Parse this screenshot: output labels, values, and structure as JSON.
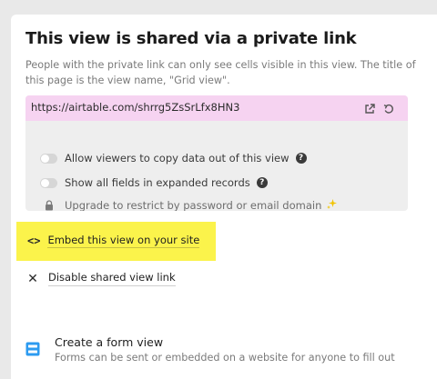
{
  "share": {
    "title": "This view is shared via a private link",
    "description": "People with the private link can only see cells visible in this view. The title of this page is the view name, \"Grid view\".",
    "url": "https://airtable.com/shrrg5ZsSrLfx8HN3",
    "url_actions": [
      {
        "icon": "external-link-icon"
      },
      {
        "icon": "regenerate-icon"
      }
    ],
    "options": [
      {
        "label": "Allow viewers to copy data out of this view",
        "control": "toggle",
        "enabled": false,
        "help": "?"
      },
      {
        "label": "Show all fields in expanded records",
        "control": "toggle",
        "enabled": false,
        "help": "?"
      },
      {
        "label": "Upgrade to restrict by password or email domain",
        "control": "lock-icon",
        "badge_icon": "sparkle-icon"
      }
    ]
  },
  "actions": {
    "embed_label": "Embed this view on your site",
    "embed_icon": "<>",
    "embed_highlight": "#fbf34b",
    "disable_label": "Disable shared view link",
    "disable_icon": "✕"
  },
  "form": {
    "title": "Create a form view",
    "description": "Forms can be sent or embedded on a website for anyone to fill out",
    "icon_color": "#2d9bf0"
  },
  "colors": {
    "url_bg": "#f6d3f1",
    "options_bg": "#eeeeee",
    "sparkle": "#f2c300"
  }
}
